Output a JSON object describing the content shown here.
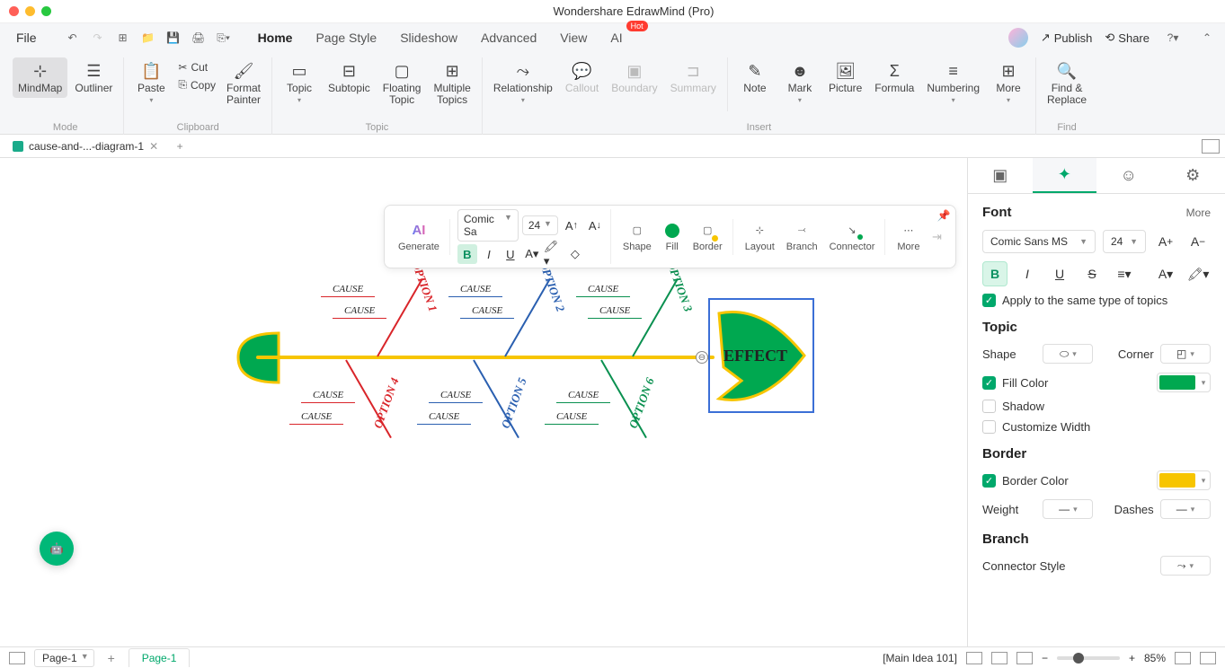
{
  "title": "Wondershare EdrawMind (Pro)",
  "menu": {
    "file": "File",
    "tabs": [
      "Home",
      "Page Style",
      "Slideshow",
      "Advanced",
      "View",
      "AI"
    ],
    "active_tab": "Home",
    "hot": "Hot",
    "publish": "Publish",
    "share": "Share"
  },
  "ribbon": {
    "mode": {
      "mindmap": "MindMap",
      "outliner": "Outliner",
      "label": "Mode"
    },
    "clipboard": {
      "paste": "Paste",
      "cut": "Cut",
      "copy": "Copy",
      "format_painter": "Format\nPainter",
      "label": "Clipboard"
    },
    "topic": {
      "topic": "Topic",
      "subtopic": "Subtopic",
      "floating": "Floating\nTopic",
      "multiple": "Multiple\nTopics",
      "label": "Topic"
    },
    "insert": {
      "relationship": "Relationship",
      "callout": "Callout",
      "boundary": "Boundary",
      "summary": "Summary",
      "note": "Note",
      "mark": "Mark",
      "picture": "Picture",
      "formula": "Formula",
      "numbering": "Numbering",
      "more": "More",
      "label": "Insert"
    },
    "find": {
      "find": "Find &\nReplace",
      "label": "Find"
    }
  },
  "doctab": {
    "name": "cause-and-...-diagram-1"
  },
  "floatbar": {
    "ai": "AI",
    "generate": "Generate",
    "font": "Comic Sa",
    "size": "24",
    "shape": "Shape",
    "fill": "Fill",
    "border": "Border",
    "layout": "Layout",
    "branch": "Branch",
    "connector": "Connector",
    "more": "More"
  },
  "diagram": {
    "effect": "EFFECT",
    "options": [
      "OPTION 1",
      "OPTION 2",
      "OPTION 3",
      "OPTION 4",
      "OPTION 5",
      "OPTION 6"
    ],
    "cause": "CAUSE"
  },
  "panel": {
    "font": {
      "title": "Font",
      "more": "More",
      "family": "Comic Sans MS",
      "size": "24",
      "apply": "Apply to the same type of topics"
    },
    "topic": {
      "title": "Topic",
      "shape": "Shape",
      "corner": "Corner",
      "fill": "Fill Color",
      "shadow": "Shadow",
      "custom": "Customize Width"
    },
    "border": {
      "title": "Border",
      "color": "Border Color",
      "weight": "Weight",
      "dashes": "Dashes"
    },
    "branch": {
      "title": "Branch",
      "connector": "Connector Style"
    }
  },
  "statusbar": {
    "page_sel": "Page-1",
    "page_tab": "Page-1",
    "main_idea": "[Main Idea 101]",
    "zoom": "85%"
  }
}
